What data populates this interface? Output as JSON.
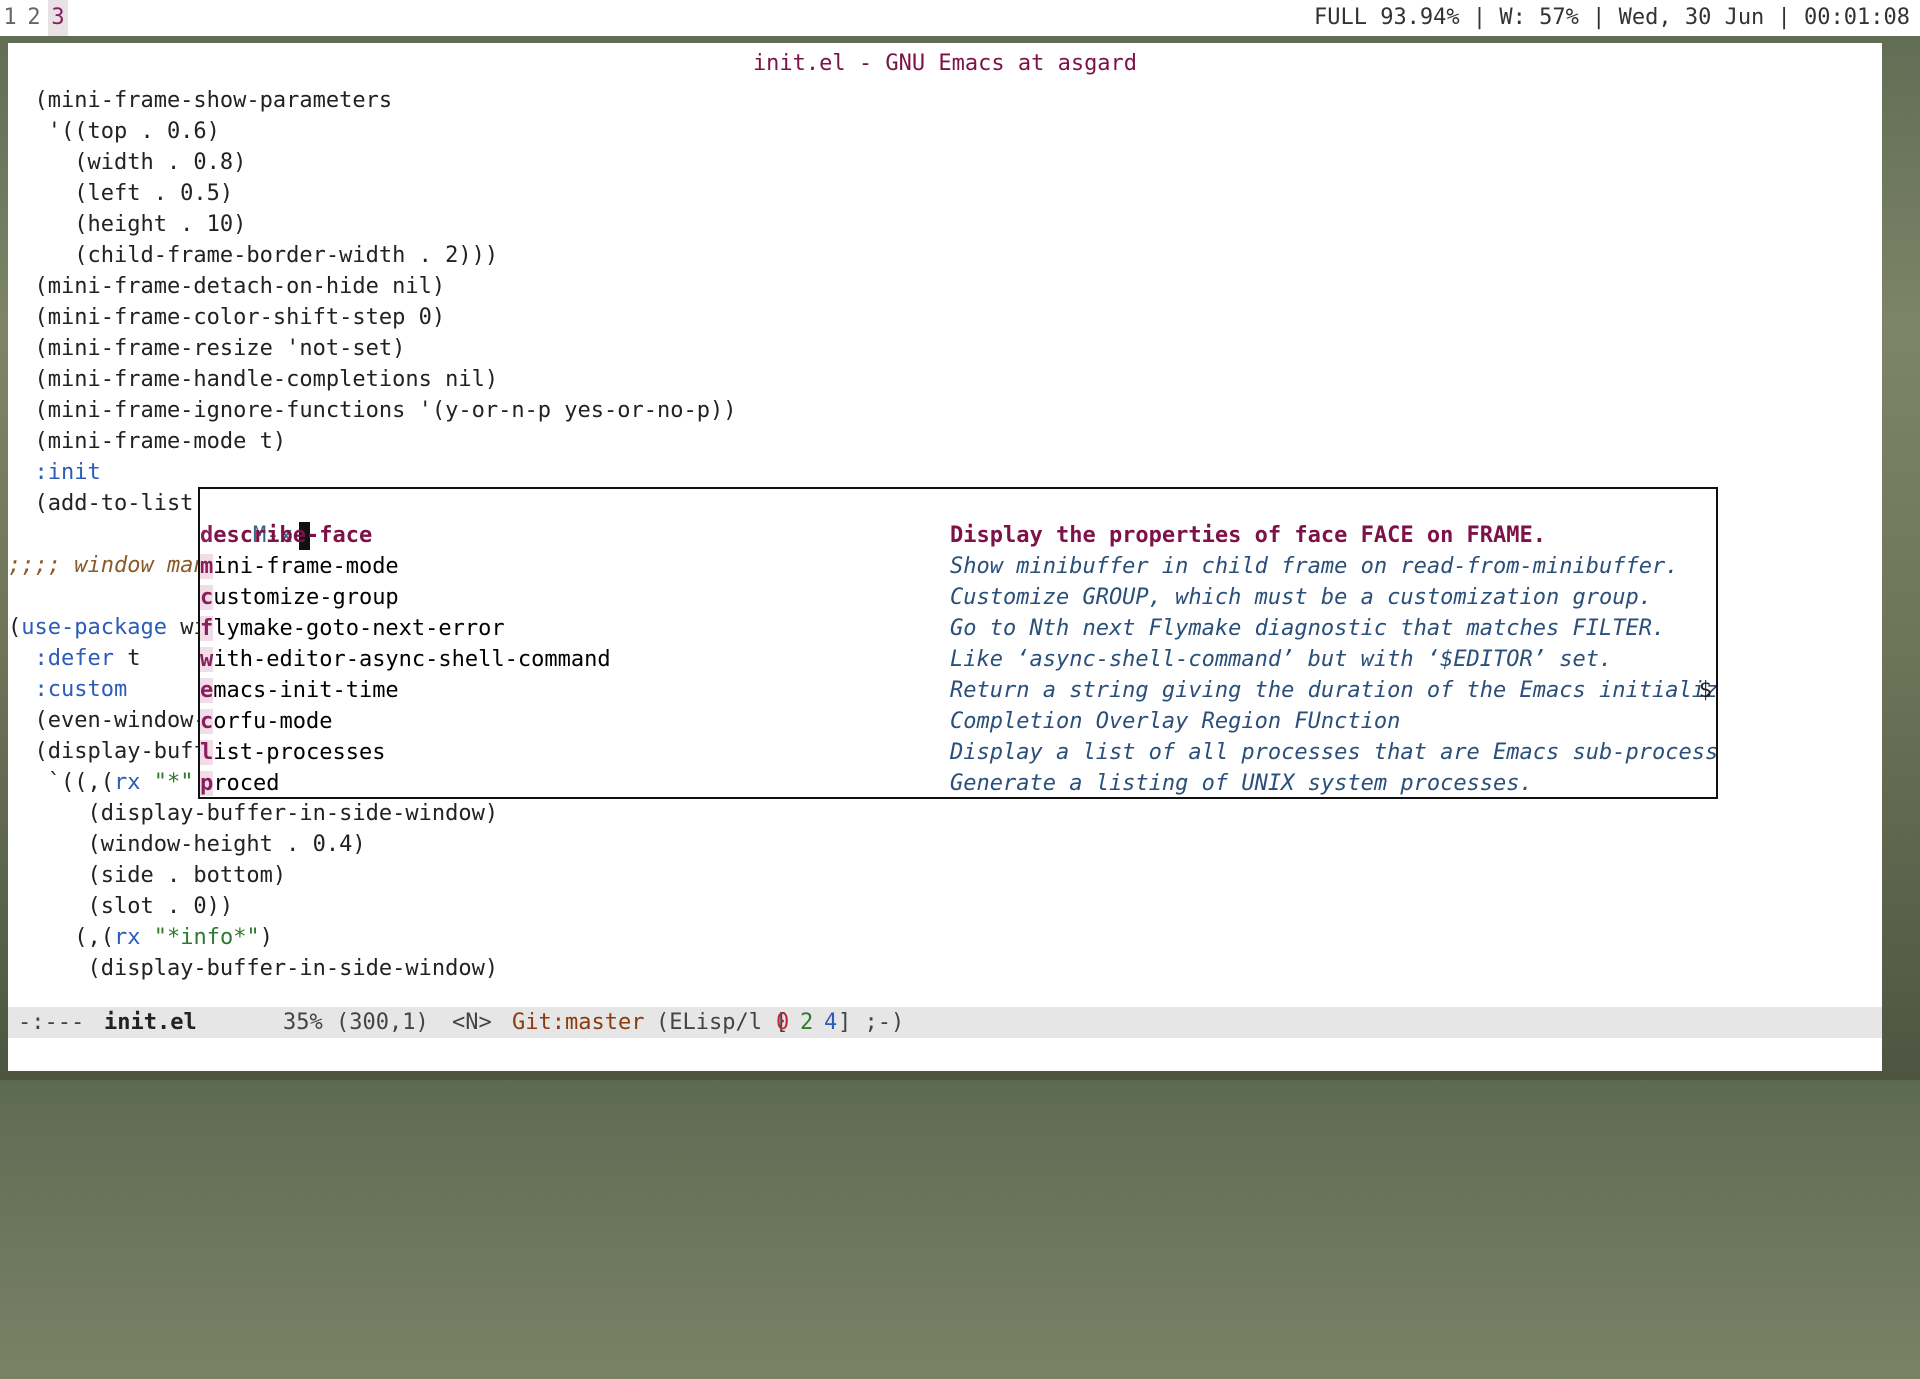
{
  "topbar": {
    "workspaces": [
      "1",
      "2",
      "3"
    ],
    "status": "FULL 93.94% | W: 57% | Wed, 30 Jun | 00:01:08"
  },
  "window": {
    "title": "init.el - GNU Emacs at asgard"
  },
  "buffer": {
    "lines": [
      "  (mini-frame-show-parameters",
      "   '((top . 0.6)",
      "     (width . 0.8)",
      "     (left . 0.5)",
      "     (height . 10)",
      "     (child-frame-border-width . 2)))",
      "  (mini-frame-detach-on-hide nil)",
      "  (mini-frame-color-shift-step 0)",
      "  (mini-frame-resize 'not-set)",
      "  (mini-frame-handle-completions nil)",
      "  (mini-frame-ignore-functions '(y-or-n-p yes-or-no-p))",
      "  (mini-frame-mode t)",
      "  :init",
      "  (add-to-list '",
      "",
      ";;;; window mana",
      "",
      "(use-package win",
      "  :defer t",
      "  :custom",
      "  (even-window-s",
      "  (display-buffe",
      "   `((,(rx \"*\" (| \"H\" \"h\") \"elp\" (? \"ful\" (* nonl)) \"*\")",
      "      (display-buffer-in-side-window)",
      "      (window-height . 0.4)",
      "      (side . bottom)",
      "      (slot . 0))",
      "     (,(rx \"*info*\")",
      "      (display-buffer-in-side-window)"
    ]
  },
  "minibuffer": {
    "prompt": "M-x",
    "candidates": [
      {
        "name": "describe-face",
        "doc": "Display the properties of face FACE on FRAME."
      },
      {
        "name": "mini-frame-mode",
        "doc": "Show minibuffer in child frame on read-from-minibuffer."
      },
      {
        "name": "customize-group",
        "doc": "Customize GROUP, which must be a customization group."
      },
      {
        "name": "flymake-goto-next-error",
        "doc": "Go to Nth next Flymake diagnostic that matches FILTER."
      },
      {
        "name": "with-editor-async-shell-command",
        "doc": "Like ‘async-shell-command’ but with ‘$EDITOR’ set."
      },
      {
        "name": "emacs-init-time",
        "doc": "Return a string giving the duration of the Emacs initializatio"
      },
      {
        "name": "corfu-mode",
        "doc": "Completion Overlay Region FUnction"
      },
      {
        "name": "list-processes",
        "doc": "Display a list of all processes that are Emacs sub-processes."
      },
      {
        "name": "proced",
        "doc": "Generate a listing of UNIX system processes."
      }
    ],
    "truncation_marker": "$"
  },
  "modeline": {
    "state": "-:---",
    "buffer_name": "init.el",
    "position": "35% (300,1)",
    "evil_state": "<N>",
    "vc": "Git:master",
    "mode_open": "(ELisp/l [",
    "err": "0",
    "warn": "2",
    "info": "4",
    "mode_close": "] ;-)"
  },
  "colors": {
    "accent": "#7d1248",
    "keyword": "#2c5bb8",
    "string": "#2f7a2f",
    "comment": "#8a5a2b"
  }
}
